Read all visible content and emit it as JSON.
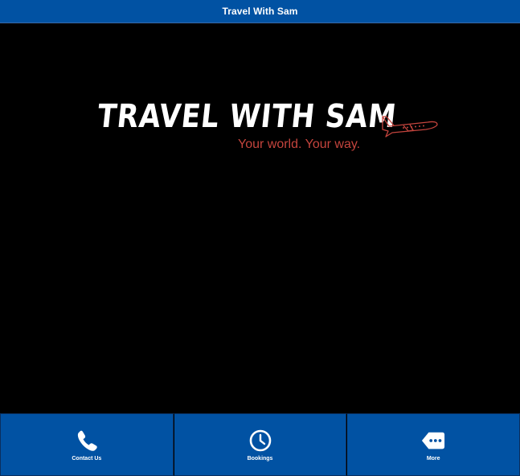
{
  "header": {
    "title": "Travel With Sam"
  },
  "logo": {
    "title": "TRAVEL WITH SAM",
    "tagline": "Your world. Your way."
  },
  "tabs": [
    {
      "label": "Contact Us",
      "icon": "phone-icon"
    },
    {
      "label": "Bookings",
      "icon": "clock-icon"
    },
    {
      "label": "More",
      "icon": "more-icon"
    }
  ],
  "colors": {
    "header_bg": "#0152a3",
    "tab_bg": "#0152a3",
    "tagline": "#c4443d",
    "content_bg": "#000000"
  }
}
